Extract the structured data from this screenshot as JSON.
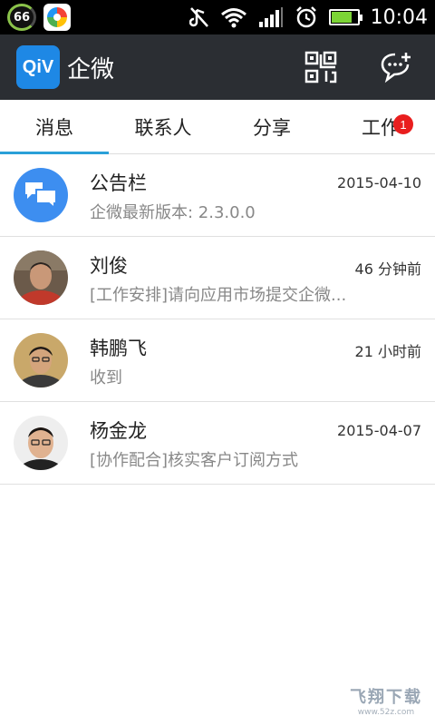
{
  "status_bar": {
    "battery_indicator": "66",
    "time": "10:04",
    "battery_level": 0.75
  },
  "app_bar": {
    "logo_text": "QiV",
    "title": "企微"
  },
  "tabs": [
    {
      "label": "消息",
      "active": true
    },
    {
      "label": "联系人",
      "active": false
    },
    {
      "label": "分享",
      "active": false
    },
    {
      "label": "工作",
      "active": false,
      "badge": "1"
    }
  ],
  "messages": [
    {
      "name": "公告栏",
      "time": "2015-04-10",
      "preview": "企微最新版本: 2.3.0.0",
      "avatar": "bulletin-board-icon"
    },
    {
      "name": "刘俊",
      "time": "46 分钟前",
      "preview": "[工作安排]请向应用市场提交企微...",
      "avatar": "user-photo"
    },
    {
      "name": "韩鹏飞",
      "time": "21 小时前",
      "preview": "收到",
      "avatar": "user-photo"
    },
    {
      "name": "杨金龙",
      "time": "2015-04-07",
      "preview": "[协作配合]核实客户订阅方式",
      "avatar": "user-photo"
    }
  ],
  "watermark": {
    "title": "飞翔下载",
    "url": "www.52z.com"
  },
  "colors": {
    "app_bar": "#2b2e33",
    "tab_indicator": "#2aa0d8",
    "badge": "#e91e1e",
    "logo": "#1e88e5",
    "bulletin_avatar": "#3d8ef0"
  }
}
